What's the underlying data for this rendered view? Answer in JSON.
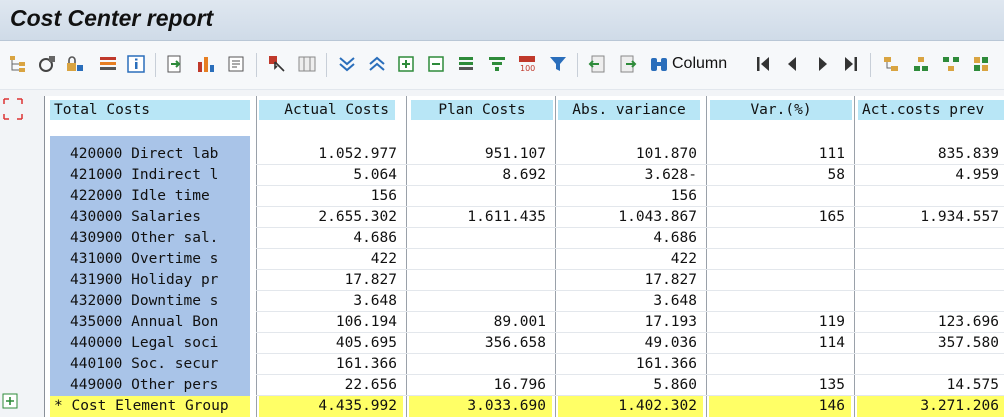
{
  "window": {
    "title": "Cost Center report"
  },
  "toolbar": {
    "column_label": "Column",
    "icons": [
      "hierarchy-icon",
      "refresh-icon",
      "lock-icon",
      "layout-icon",
      "info-icon",
      "export-icon",
      "chart-icon",
      "print-icon",
      "select-icon",
      "columns-icon",
      "sort-down-icon",
      "sort-up-icon",
      "expand-icon",
      "collapse-icon",
      "subtotal-icon",
      "filter-icon",
      "topn-icon",
      "funnel-icon",
      "previous-report-icon",
      "next-report-icon",
      "binoculars-icon",
      "first-page-icon",
      "prev-page-icon",
      "next-page-icon",
      "last-page-icon",
      "drilldown-1-icon",
      "drilldown-2-icon",
      "drilldown-3-icon",
      "drilldown-4-icon"
    ],
    "accent_color": "#2a6ebb"
  },
  "table": {
    "headers": [
      "Total Costs",
      "Actual Costs",
      "Plan Costs",
      "Abs. variance",
      "Var.(%)",
      "Act.costs prev"
    ],
    "rows": [
      {
        "name": "420000  Direct lab",
        "actual": "1.052.977",
        "plan": "951.107",
        "abs": "101.870",
        "var": "111",
        "prev": "835.839"
      },
      {
        "name": "421000  Indirect l",
        "actual": "5.064",
        "plan": "8.692",
        "abs": "3.628-",
        "var": "58",
        "prev": "4.959"
      },
      {
        "name": "422000  Idle time",
        "actual": "156",
        "plan": "",
        "abs": "156",
        "var": "",
        "prev": ""
      },
      {
        "name": "430000  Salaries",
        "actual": "2.655.302",
        "plan": "1.611.435",
        "abs": "1.043.867",
        "var": "165",
        "prev": "1.934.557"
      },
      {
        "name": "430900  Other sal.",
        "actual": "4.686",
        "plan": "",
        "abs": "4.686",
        "var": "",
        "prev": ""
      },
      {
        "name": "431000  Overtime s",
        "actual": "422",
        "plan": "",
        "abs": "422",
        "var": "",
        "prev": ""
      },
      {
        "name": "431900  Holiday pr",
        "actual": "17.827",
        "plan": "",
        "abs": "17.827",
        "var": "",
        "prev": ""
      },
      {
        "name": "432000  Downtime s",
        "actual": "3.648",
        "plan": "",
        "abs": "3.648",
        "var": "",
        "prev": ""
      },
      {
        "name": "435000  Annual Bon",
        "actual": "106.194",
        "plan": "89.001",
        "abs": "17.193",
        "var": "119",
        "prev": "123.696"
      },
      {
        "name": "440000  Legal soci",
        "actual": "405.695",
        "plan": "356.658",
        "abs": "49.036",
        "var": "114",
        "prev": "357.580"
      },
      {
        "name": "440100  Soc. secur",
        "actual": "161.366",
        "plan": "",
        "abs": "161.366",
        "var": "",
        "prev": ""
      },
      {
        "name": "449000  Other pers",
        "actual": "22.656",
        "plan": "16.796",
        "abs": "5.860",
        "var": "135",
        "prev": "14.575"
      }
    ],
    "total": {
      "name": "* Cost Element Group",
      "actual": "4.435.992",
      "plan": "3.033.690",
      "abs": "1.402.302",
      "var": "146",
      "prev": "3.271.206"
    },
    "colors": {
      "header_bg": "#b8e6f6",
      "name_bg": "#a9c4e8",
      "total_bg": "#ffff66"
    }
  }
}
